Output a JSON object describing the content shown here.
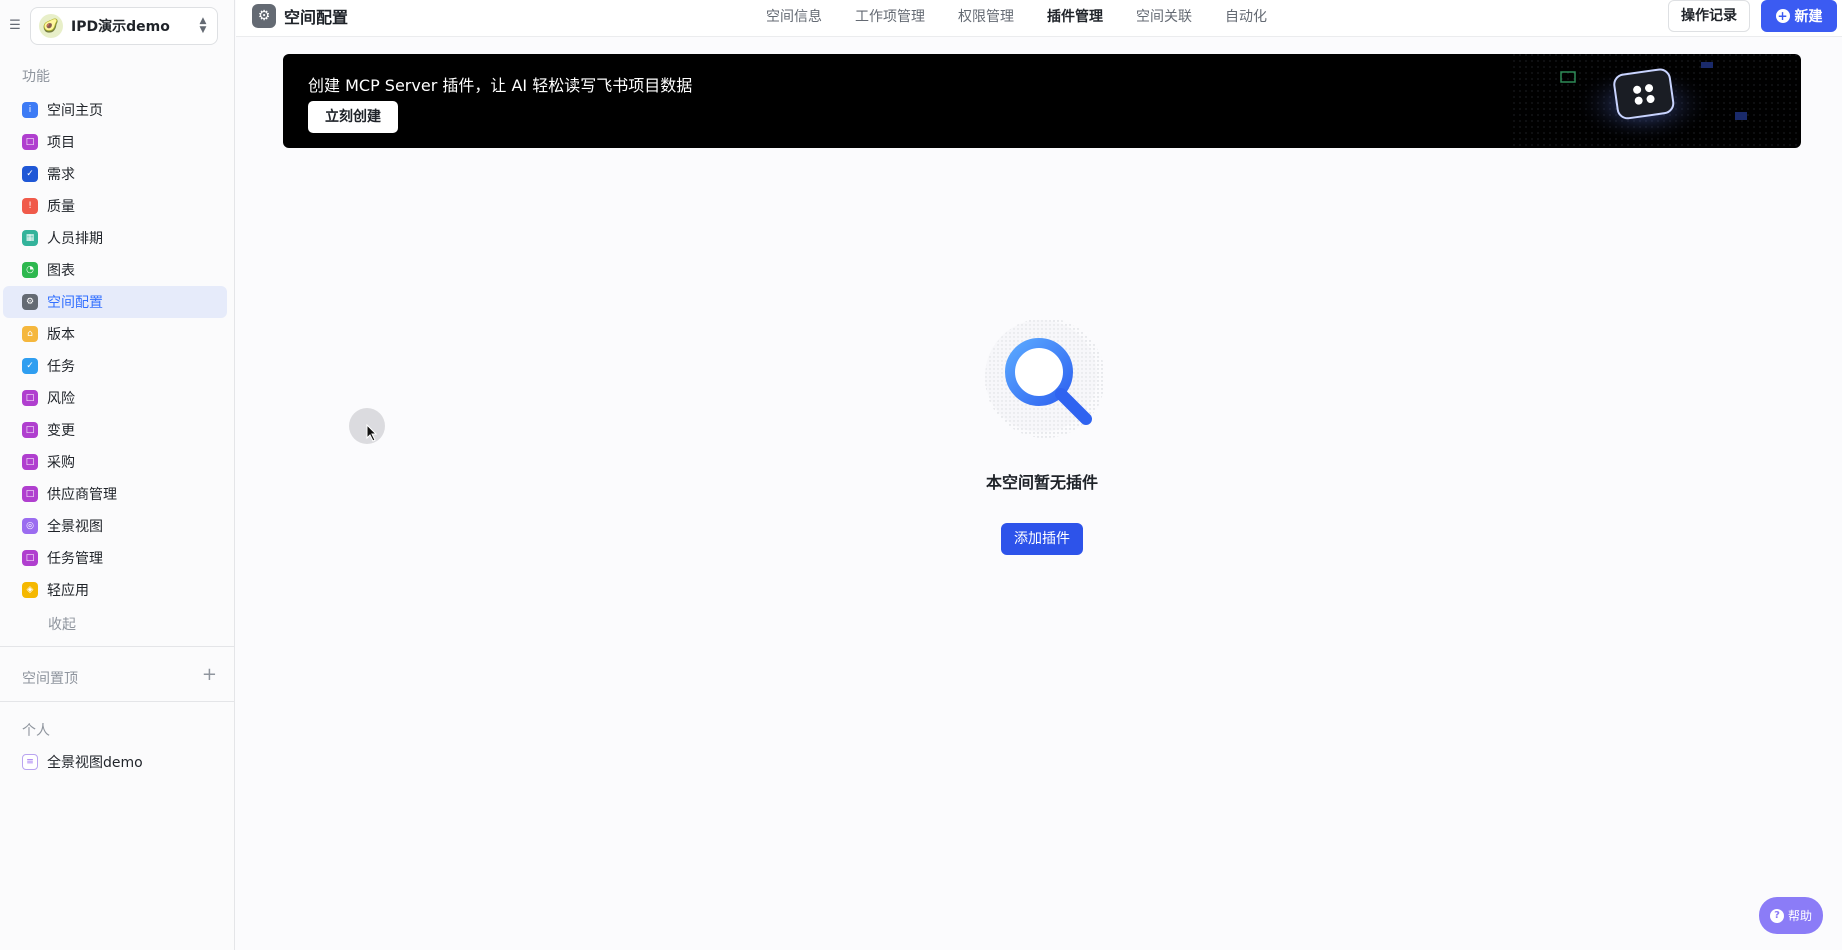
{
  "space": {
    "name": "IPD演示demo",
    "avatar_icon": "avocado-icon"
  },
  "sidebar": {
    "section_function": "功能",
    "items": [
      {
        "label": "空间主页",
        "icon": "info-icon",
        "color": "#3d7bf5",
        "glyph": "i"
      },
      {
        "label": "项目",
        "icon": "bookmark-icon",
        "color": "#b03fcf",
        "glyph": "□"
      },
      {
        "label": "需求",
        "icon": "check-circle-icon",
        "color": "#1f57d6",
        "glyph": "✓"
      },
      {
        "label": "质量",
        "icon": "alert-icon",
        "color": "#f05a4a",
        "glyph": "!"
      },
      {
        "label": "人员排期",
        "icon": "calendar-icon",
        "color": "#33b39b",
        "glyph": "▦"
      },
      {
        "label": "图表",
        "icon": "chart-icon",
        "color": "#2eb84f",
        "glyph": "◔"
      },
      {
        "label": "空间配置",
        "icon": "gear-icon",
        "color": "#646a73",
        "glyph": "⚙"
      },
      {
        "label": "版本",
        "icon": "tag-icon",
        "color": "#f5b73d",
        "glyph": "⌂"
      },
      {
        "label": "任务",
        "icon": "check-circle-icon",
        "color": "#2f9ef0",
        "glyph": "✓"
      },
      {
        "label": "风险",
        "icon": "bookmark-icon",
        "color": "#b03fcf",
        "glyph": "□"
      },
      {
        "label": "变更",
        "icon": "bookmark-icon",
        "color": "#b03fcf",
        "glyph": "□"
      },
      {
        "label": "采购",
        "icon": "bookmark-icon",
        "color": "#b03fcf",
        "glyph": "□"
      },
      {
        "label": "供应商管理",
        "icon": "bookmark-icon",
        "color": "#b03fcf",
        "glyph": "□"
      },
      {
        "label": "全景视图",
        "icon": "panorama-icon",
        "color": "#9b6cf0",
        "glyph": "◎"
      },
      {
        "label": "任务管理",
        "icon": "bookmark-icon",
        "color": "#b03fcf",
        "glyph": "□"
      },
      {
        "label": "轻应用",
        "icon": "app-icon",
        "color": "#f5b800",
        "glyph": "◈"
      }
    ],
    "active_index": 6,
    "collapse_label": "收起",
    "section_pinned": "空间置顶",
    "section_personal": "个人",
    "personal_items": [
      {
        "label": "全景视图demo",
        "icon": "list-icon"
      }
    ]
  },
  "header": {
    "title": "空间配置",
    "tabs": [
      {
        "label": "空间信息",
        "active": false
      },
      {
        "label": "工作项管理",
        "active": false
      },
      {
        "label": "权限管理",
        "active": false
      },
      {
        "label": "插件管理",
        "active": true
      },
      {
        "label": "空间关联",
        "active": false
      },
      {
        "label": "自动化",
        "active": false
      }
    ],
    "log_button": "操作记录",
    "new_button": "新建"
  },
  "banner": {
    "text": "创建 MCP Server 插件，让 AI 轻松读写飞书项目数据",
    "button": "立刻创建"
  },
  "empty": {
    "message": "本空间暂无插件",
    "add_button": "添加插件"
  },
  "help": {
    "label": "帮助"
  },
  "colors": {
    "accent": "#3b5bf2",
    "active_bg": "#e6ebfa",
    "help": "#8b7cf7"
  }
}
